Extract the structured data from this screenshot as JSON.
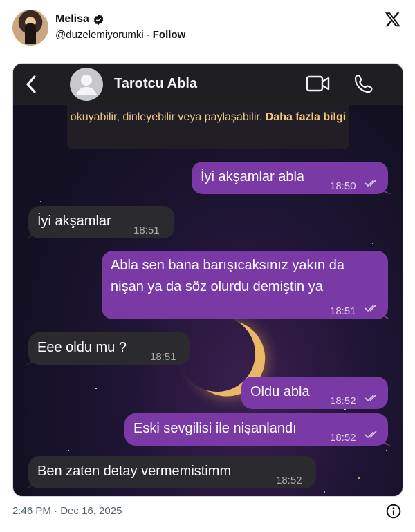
{
  "tweet": {
    "display_name": "Melisa",
    "handle": "@duzelemiyorumki",
    "separator": "·",
    "follow_label": "Follow",
    "timestamp": "2:46 PM · Dec 16, 2025"
  },
  "chat": {
    "contact_name": "Tarotcu Abla",
    "notice_text": "okuyabilir, dinleyebilir veya paylaşabilir.",
    "notice_more": "Daha fazla bilgi",
    "messages": [
      {
        "direction": "out",
        "text": "İyi akşamlar abla",
        "time": "18:50"
      },
      {
        "direction": "in",
        "text": "İyi akşamlar",
        "time": "18:51"
      },
      {
        "direction": "out",
        "text": "Abla sen bana barışıcaksınız yakın da\nnişan ya da söz olurdu demiştin ya",
        "time": "18:51"
      },
      {
        "direction": "in",
        "text": "Eee oldu mu ?",
        "time": "18:51"
      },
      {
        "direction": "out",
        "text": "Oldu abla",
        "time": "18:52"
      },
      {
        "direction": "out",
        "text": "Eski sevgilisi ile nişanlandı",
        "time": "18:52"
      },
      {
        "direction": "in",
        "text": "Ben zaten detay vermemistimm",
        "time": "18:52"
      }
    ]
  },
  "colors": {
    "outgoing_bubble": "#7a3aa6",
    "incoming_bubble": "#2b2a2e",
    "chat_header": "#1f1f21",
    "notice_text": "#e8c98a"
  }
}
